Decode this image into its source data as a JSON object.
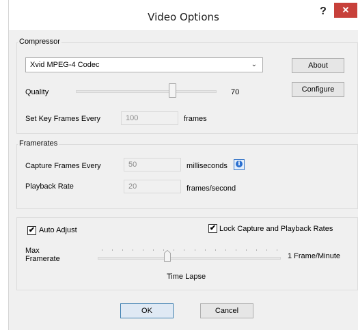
{
  "window": {
    "title": "Video Options",
    "help_label": "?",
    "close_label": "✕"
  },
  "compressor": {
    "group_label": "Compressor",
    "codec_selected": "Xvid MPEG-4 Codec",
    "about_label": "About",
    "configure_label": "Configure",
    "quality_label": "Quality",
    "quality_value": "70",
    "quality_level": 70,
    "keyframes_label": "Set Key Frames Every",
    "keyframes_value": "100",
    "keyframes_unit": "frames"
  },
  "framerates": {
    "group_label": "Framerates",
    "capture_label": "Capture Frames Every",
    "capture_value": "50",
    "capture_unit": "milliseconds",
    "playback_label": "Playback Rate",
    "playback_value": "20",
    "playback_unit": "frames/second"
  },
  "auto": {
    "auto_adjust_label": "Auto Adjust",
    "auto_adjust_checked": true,
    "lock_label": "Lock Capture and Playback Rates",
    "lock_checked": true,
    "max_framerate_label_line1": "Max",
    "max_framerate_label_line2": "Framerate",
    "slider_right_label": "1 Frame/Minute",
    "slider_bottom_label": "Time Lapse"
  },
  "footer": {
    "ok_label": "OK",
    "cancel_label": "Cancel"
  },
  "colors": {
    "close_button": "#c7403a",
    "info_icon": "#2a6fd0",
    "default_button_border": "#3c7fb1"
  }
}
